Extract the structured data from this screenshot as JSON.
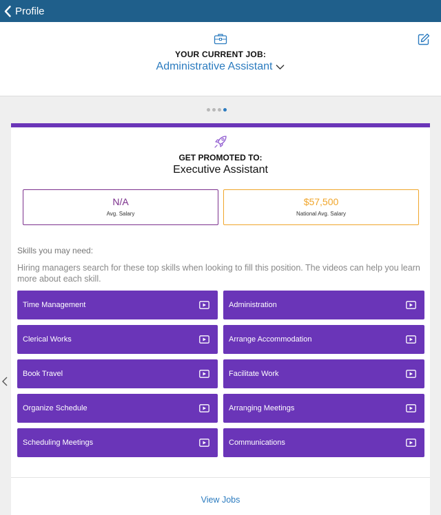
{
  "navbar": {
    "back_label": "Profile",
    "bg_color": "#1f5f8b"
  },
  "current_job": {
    "label": "YOUR CURRENT JOB:",
    "title": "Administrative Assistant",
    "icon": "briefcase-icon",
    "edit_icon": "edit-icon",
    "dropdown_icon": "chevron-down-icon"
  },
  "pager": {
    "total": 4,
    "active": 4
  },
  "promotion": {
    "label": "GET PROMOTED TO:",
    "title": "Executive Assistant",
    "icon": "rocket-icon",
    "accent_color": "#6a35b8"
  },
  "salaries": {
    "avg": {
      "value": "N/A",
      "caption": "Avg. Salary",
      "color": "#7b2f8c"
    },
    "national": {
      "value": "$57,500",
      "caption": "National Avg. Salary",
      "color": "#f0a52a"
    }
  },
  "skills": {
    "heading": "Skills you may need:",
    "description": "Hiring managers search for these top skills when looking to fill this position. The videos can help you learn more about each skill.",
    "items": [
      {
        "label": "Time Management"
      },
      {
        "label": "Administration"
      },
      {
        "label": "Clerical Works"
      },
      {
        "label": "Arrange Accommodation"
      },
      {
        "label": "Book Travel"
      },
      {
        "label": "Facilitate Work"
      },
      {
        "label": "Organize Schedule"
      },
      {
        "label": "Arranging Meetings"
      },
      {
        "label": "Scheduling Meetings"
      },
      {
        "label": "Communications"
      }
    ]
  },
  "footer": {
    "view_jobs_label": "View Jobs",
    "link_color": "#2b7bbf"
  }
}
